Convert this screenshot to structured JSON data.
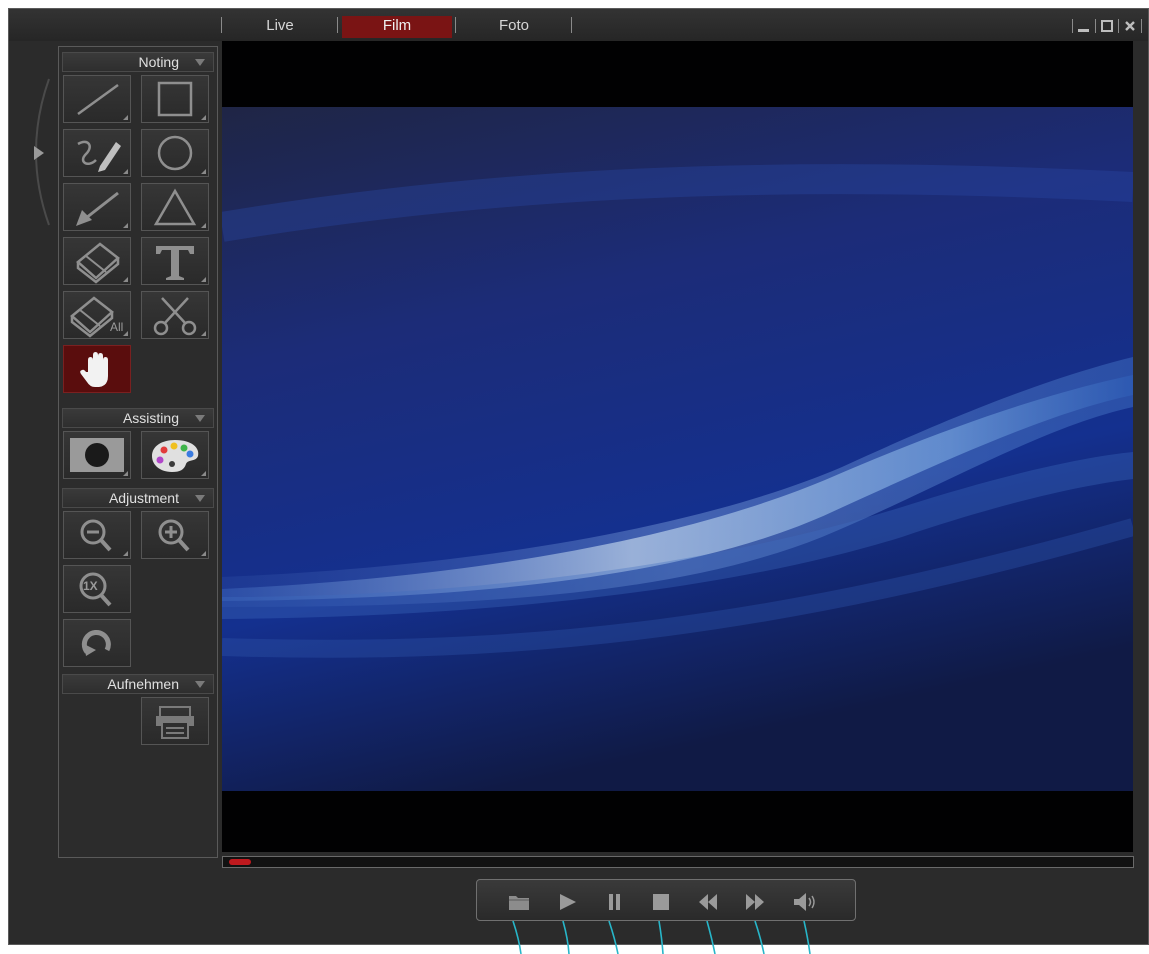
{
  "tabs": [
    {
      "label": "Live",
      "active": false
    },
    {
      "label": "Film",
      "active": true
    },
    {
      "label": "Foto",
      "active": false
    }
  ],
  "window_controls": [
    "minimize-icon",
    "maximize-icon",
    "close-icon"
  ],
  "sections": {
    "noting": "Noting",
    "assisting": "Assisting",
    "adjustment": "Adjustment",
    "aufnehmen": "Aufnehmen"
  },
  "noting_tools": [
    "line-icon",
    "rectangle-icon",
    "freehand-pen-icon",
    "circle-icon",
    "arrow-icon",
    "triangle-icon",
    "eraser-icon",
    "text-icon",
    "erase-all-icon",
    "scissors-icon",
    "hand-icon"
  ],
  "erase_all_badge": "All",
  "assisting_tools": [
    "color-fill-icon",
    "palette-icon"
  ],
  "adjustment_tools": [
    "zoom-out-icon",
    "zoom-in-icon",
    "zoom-reset-icon",
    "rotate-icon"
  ],
  "zoom_reset_label": "1X",
  "aufnehmen_tools": [
    "print-icon"
  ],
  "active_tool": "hand-icon",
  "playback_progress": 0.02,
  "playback_controls": [
    "open-folder-icon",
    "play-icon",
    "pause-icon",
    "stop-icon",
    "rewind-icon",
    "fast-forward-icon",
    "volume-icon"
  ],
  "colors": {
    "accent": "#7a1414",
    "progress": "#c0191e",
    "callout": "#27b6c9",
    "background": "#2b2b2b"
  }
}
